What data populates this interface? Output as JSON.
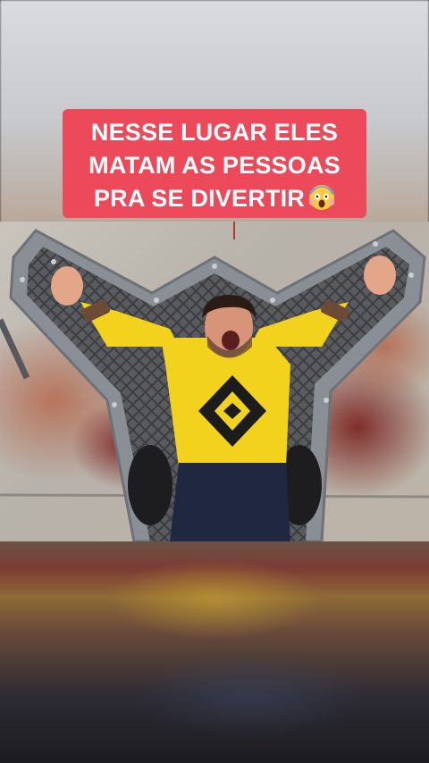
{
  "caption": {
    "line1": "NESSE LUGAR ELES",
    "line2": "MATAM AS PESSOAS",
    "line3": "PRA SE DIVERTIR",
    "emoji": "😱"
  },
  "colors": {
    "caption_bg": "#ec4a5a",
    "caption_text": "#ffffff",
    "shirt": "#f2d21d",
    "frame": "#8a8f96"
  },
  "icons": {
    "emoji": "screaming-face-icon"
  }
}
